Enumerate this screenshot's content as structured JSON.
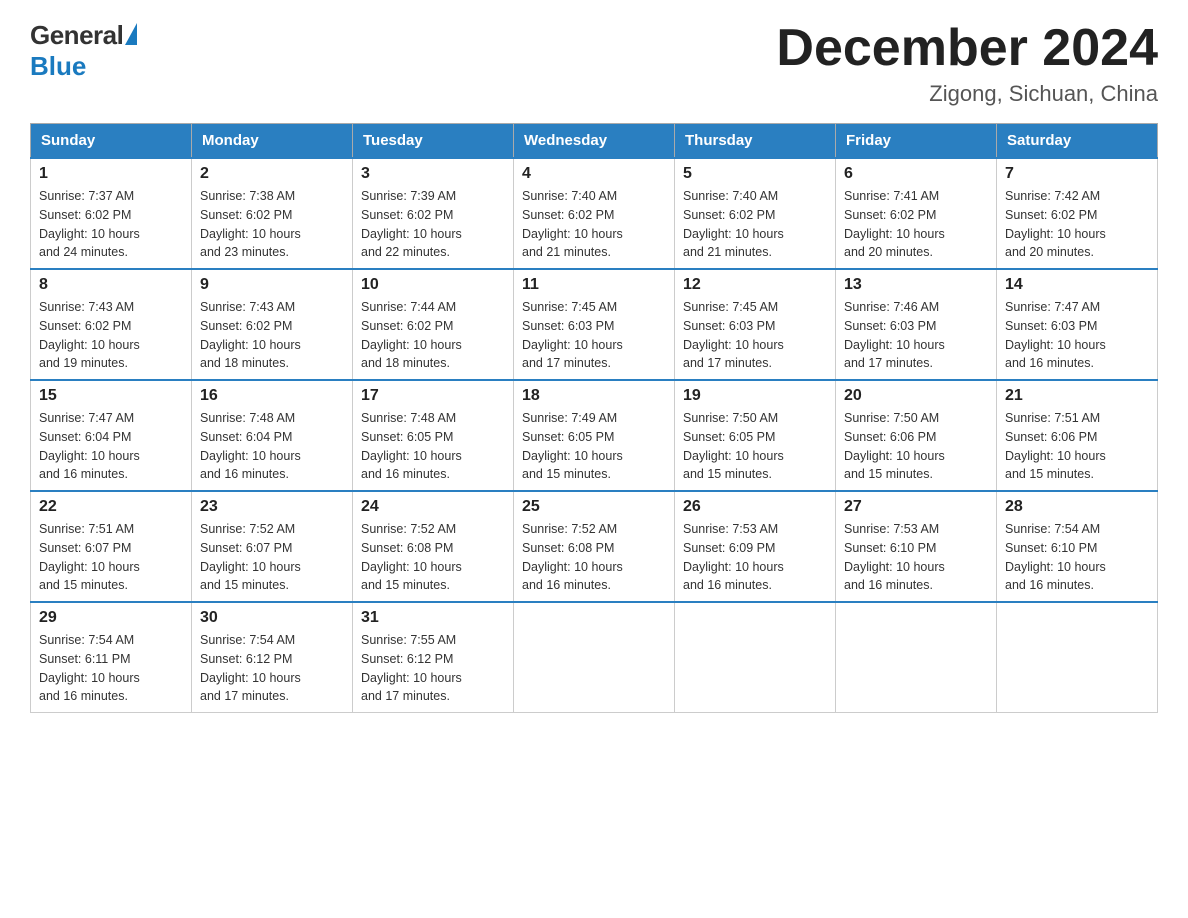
{
  "logo": {
    "general_text": "General",
    "blue_text": "Blue"
  },
  "header": {
    "month_year": "December 2024",
    "location": "Zigong, Sichuan, China"
  },
  "days_of_week": [
    "Sunday",
    "Monday",
    "Tuesday",
    "Wednesday",
    "Thursday",
    "Friday",
    "Saturday"
  ],
  "weeks": [
    [
      {
        "day": "1",
        "sunrise": "7:37 AM",
        "sunset": "6:02 PM",
        "daylight": "10 hours and 24 minutes."
      },
      {
        "day": "2",
        "sunrise": "7:38 AM",
        "sunset": "6:02 PM",
        "daylight": "10 hours and 23 minutes."
      },
      {
        "day": "3",
        "sunrise": "7:39 AM",
        "sunset": "6:02 PM",
        "daylight": "10 hours and 22 minutes."
      },
      {
        "day": "4",
        "sunrise": "7:40 AM",
        "sunset": "6:02 PM",
        "daylight": "10 hours and 21 minutes."
      },
      {
        "day": "5",
        "sunrise": "7:40 AM",
        "sunset": "6:02 PM",
        "daylight": "10 hours and 21 minutes."
      },
      {
        "day": "6",
        "sunrise": "7:41 AM",
        "sunset": "6:02 PM",
        "daylight": "10 hours and 20 minutes."
      },
      {
        "day": "7",
        "sunrise": "7:42 AM",
        "sunset": "6:02 PM",
        "daylight": "10 hours and 20 minutes."
      }
    ],
    [
      {
        "day": "8",
        "sunrise": "7:43 AM",
        "sunset": "6:02 PM",
        "daylight": "10 hours and 19 minutes."
      },
      {
        "day": "9",
        "sunrise": "7:43 AM",
        "sunset": "6:02 PM",
        "daylight": "10 hours and 18 minutes."
      },
      {
        "day": "10",
        "sunrise": "7:44 AM",
        "sunset": "6:02 PM",
        "daylight": "10 hours and 18 minutes."
      },
      {
        "day": "11",
        "sunrise": "7:45 AM",
        "sunset": "6:03 PM",
        "daylight": "10 hours and 17 minutes."
      },
      {
        "day": "12",
        "sunrise": "7:45 AM",
        "sunset": "6:03 PM",
        "daylight": "10 hours and 17 minutes."
      },
      {
        "day": "13",
        "sunrise": "7:46 AM",
        "sunset": "6:03 PM",
        "daylight": "10 hours and 17 minutes."
      },
      {
        "day": "14",
        "sunrise": "7:47 AM",
        "sunset": "6:03 PM",
        "daylight": "10 hours and 16 minutes."
      }
    ],
    [
      {
        "day": "15",
        "sunrise": "7:47 AM",
        "sunset": "6:04 PM",
        "daylight": "10 hours and 16 minutes."
      },
      {
        "day": "16",
        "sunrise": "7:48 AM",
        "sunset": "6:04 PM",
        "daylight": "10 hours and 16 minutes."
      },
      {
        "day": "17",
        "sunrise": "7:48 AM",
        "sunset": "6:05 PM",
        "daylight": "10 hours and 16 minutes."
      },
      {
        "day": "18",
        "sunrise": "7:49 AM",
        "sunset": "6:05 PM",
        "daylight": "10 hours and 15 minutes."
      },
      {
        "day": "19",
        "sunrise": "7:50 AM",
        "sunset": "6:05 PM",
        "daylight": "10 hours and 15 minutes."
      },
      {
        "day": "20",
        "sunrise": "7:50 AM",
        "sunset": "6:06 PM",
        "daylight": "10 hours and 15 minutes."
      },
      {
        "day": "21",
        "sunrise": "7:51 AM",
        "sunset": "6:06 PM",
        "daylight": "10 hours and 15 minutes."
      }
    ],
    [
      {
        "day": "22",
        "sunrise": "7:51 AM",
        "sunset": "6:07 PM",
        "daylight": "10 hours and 15 minutes."
      },
      {
        "day": "23",
        "sunrise": "7:52 AM",
        "sunset": "6:07 PM",
        "daylight": "10 hours and 15 minutes."
      },
      {
        "day": "24",
        "sunrise": "7:52 AM",
        "sunset": "6:08 PM",
        "daylight": "10 hours and 15 minutes."
      },
      {
        "day": "25",
        "sunrise": "7:52 AM",
        "sunset": "6:08 PM",
        "daylight": "10 hours and 16 minutes."
      },
      {
        "day": "26",
        "sunrise": "7:53 AM",
        "sunset": "6:09 PM",
        "daylight": "10 hours and 16 minutes."
      },
      {
        "day": "27",
        "sunrise": "7:53 AM",
        "sunset": "6:10 PM",
        "daylight": "10 hours and 16 minutes."
      },
      {
        "day": "28",
        "sunrise": "7:54 AM",
        "sunset": "6:10 PM",
        "daylight": "10 hours and 16 minutes."
      }
    ],
    [
      {
        "day": "29",
        "sunrise": "7:54 AM",
        "sunset": "6:11 PM",
        "daylight": "10 hours and 16 minutes."
      },
      {
        "day": "30",
        "sunrise": "7:54 AM",
        "sunset": "6:12 PM",
        "daylight": "10 hours and 17 minutes."
      },
      {
        "day": "31",
        "sunrise": "7:55 AM",
        "sunset": "6:12 PM",
        "daylight": "10 hours and 17 minutes."
      },
      null,
      null,
      null,
      null
    ]
  ],
  "labels": {
    "sunrise": "Sunrise:",
    "sunset": "Sunset:",
    "daylight": "Daylight:"
  }
}
